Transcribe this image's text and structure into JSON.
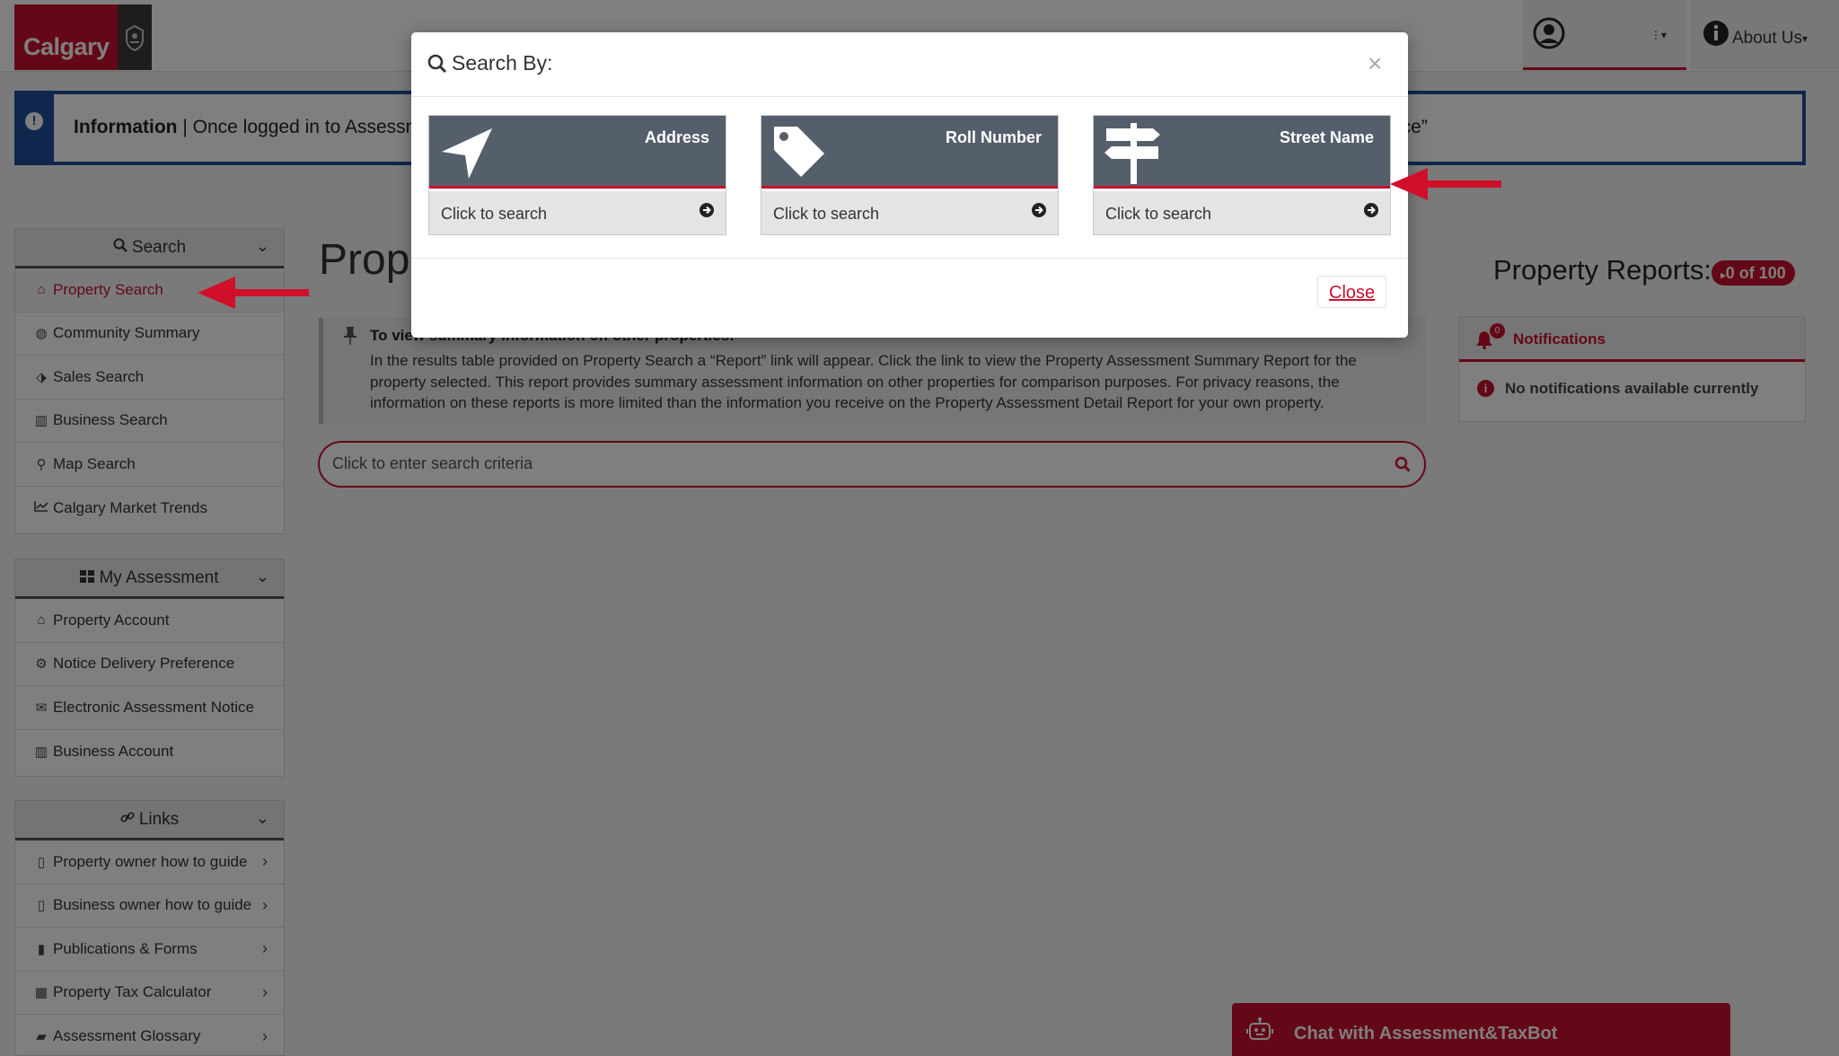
{
  "header": {
    "logo_text": "Calgary",
    "about_label": "About Us",
    "accent": "#c8102e"
  },
  "info_banner": {
    "heading": "Information",
    "separator": "|",
    "text": "Once logged in to Assessm",
    "tail": "ice”"
  },
  "sidebar": {
    "search": {
      "title": "Search",
      "items": [
        {
          "label": "Property Search",
          "icon": "home-icon"
        },
        {
          "label": "Community Summary",
          "icon": "globe-icon"
        },
        {
          "label": "Sales Search",
          "icon": "tags-icon"
        },
        {
          "label": "Business Search",
          "icon": "building-icon"
        },
        {
          "label": "Map Search",
          "icon": "map-pin-icon"
        },
        {
          "label": "Calgary Market Trends",
          "icon": "line-chart-icon"
        }
      ]
    },
    "my_assessment": {
      "title": "My Assessment",
      "items": [
        {
          "label": "Property Account",
          "icon": "home-icon"
        },
        {
          "label": "Notice Delivery Preference",
          "icon": "gear-icon"
        },
        {
          "label": "Electronic Assessment Notice",
          "icon": "envelope-open-icon"
        },
        {
          "label": "Business Account",
          "icon": "building-icon"
        }
      ]
    },
    "links": {
      "title": "Links",
      "items": [
        {
          "label": "Property owner how to guide",
          "icon": "pdf-file-icon"
        },
        {
          "label": "Business owner how to guide",
          "icon": "pdf-file-icon"
        },
        {
          "label": "Publications & Forms",
          "icon": "file-icon"
        },
        {
          "label": "Property Tax Calculator",
          "icon": "calculator-icon"
        },
        {
          "label": "Assessment Glossary",
          "icon": "book-icon"
        }
      ]
    }
  },
  "main": {
    "page_title": "Prope",
    "reports_label": "Property Reports:",
    "reports_badge": "0 of 100",
    "tip_title": "To view summary information on other properties:",
    "tip_body": "In the results table provided on Property Search a “Report” link will appear. Click the link to view the Property Assessment Summary Report for the property selected. This report provides summary assessment information on other properties for comparison purposes. For privacy reasons, the information on these reports is more limited than the information you receive on the Property Assessment Detail Report for your own property.",
    "search_placeholder": "Click to enter search criteria"
  },
  "notifications": {
    "title": "Notifications",
    "count": "0",
    "empty_text": "No notifications available currently"
  },
  "chat": {
    "label": "Chat with Assessment&TaxBot"
  },
  "modal": {
    "title": "Search By:",
    "close_x": "×",
    "options": [
      {
        "label": "Address",
        "cta": "Click to search",
        "icon": "location-arrow-icon"
      },
      {
        "label": "Roll Number",
        "cta": "Click to search",
        "icon": "tag-icon"
      },
      {
        "label": "Street Name",
        "cta": "Click to search",
        "icon": "signpost-icon"
      }
    ],
    "close_label": "Close"
  }
}
